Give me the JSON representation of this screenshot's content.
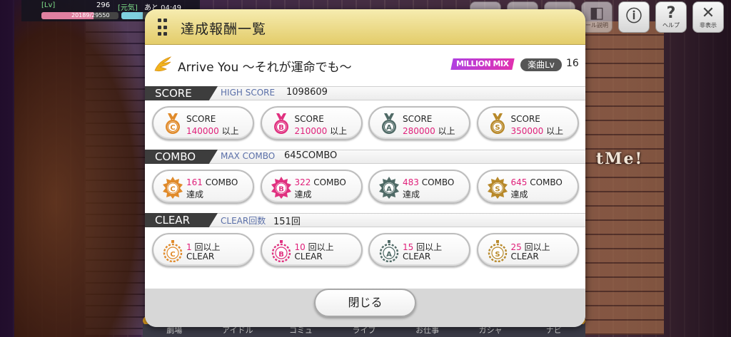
{
  "hud": {
    "lv_label": "[Lv]",
    "lv_value": "296",
    "stamina_label": "[元気]",
    "timer": "あと 04:49",
    "exp_text": "20189/29550",
    "exp_fraction": 0.68,
    "stamina_fraction": 0.3
  },
  "top_icons": {
    "help_label": "ヘルプ",
    "hide_label": "非表示",
    "tutorial_label": "ール説明"
  },
  "background": {
    "sign_text": "tMe!"
  },
  "bottom_nav": [
    "劇場",
    "アイドル",
    "コミュ",
    "ライブ",
    "お仕事",
    "ガシャ",
    "ナビ"
  ],
  "modal": {
    "title": "達成報酬一覧",
    "song_title": "Arrive You 〜それが運命でも〜",
    "mix_badge": "MILLION MIX",
    "level_label": "楽曲Lv",
    "level_value": "16",
    "close_label": "閉じる"
  },
  "sections": {
    "score": {
      "label": "SCORE",
      "stat_label": "HIGH SCORE",
      "stat_value": "1098609",
      "awards": [
        {
          "rank": "C",
          "line1": "SCORE",
          "value": "140000",
          "suffix": " 以上"
        },
        {
          "rank": "B",
          "line1": "SCORE",
          "value": "210000",
          "suffix": " 以上"
        },
        {
          "rank": "A",
          "line1": "SCORE",
          "value": "280000",
          "suffix": " 以上"
        },
        {
          "rank": "S",
          "line1": "SCORE",
          "value": "350000",
          "suffix": " 以上"
        }
      ]
    },
    "combo": {
      "label": "COMBO",
      "stat_label": "MAX COMBO",
      "stat_value": "645COMBO",
      "awards": [
        {
          "rank": "C",
          "value": "161",
          "suffix": " COMBO",
          "line2": "達成"
        },
        {
          "rank": "B",
          "value": "322",
          "suffix": " COMBO",
          "line2": "達成"
        },
        {
          "rank": "A",
          "value": "483",
          "suffix": " COMBO",
          "line2": "達成"
        },
        {
          "rank": "S",
          "value": "645",
          "suffix": " COMBO",
          "line2": "達成"
        }
      ]
    },
    "clear": {
      "label": "CLEAR",
      "stat_label": "CLEAR回数",
      "stat_value": "151回",
      "awards": [
        {
          "rank": "C",
          "value": "1",
          "suffix": " 回以上",
          "line2": "CLEAR"
        },
        {
          "rank": "B",
          "value": "10",
          "suffix": " 回以上",
          "line2": "CLEAR"
        },
        {
          "rank": "A",
          "value": "15",
          "suffix": " 回以上",
          "line2": "CLEAR"
        },
        {
          "rank": "S",
          "value": "25",
          "suffix": " 回以上",
          "line2": "CLEAR"
        }
      ]
    }
  },
  "colors": {
    "rank_C": "#e08a2a",
    "rank_B": "#e0307f",
    "rank_A": "#4f6a66",
    "rank_S": "#b8892a",
    "accent_pink": "#e0207a"
  }
}
